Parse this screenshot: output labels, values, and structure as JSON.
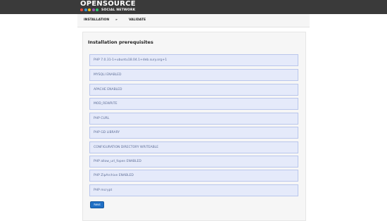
{
  "header": {
    "logo_title": "OPENSOURCE",
    "logo_subtitle": "SOCIAL NETWORK",
    "logo_dot_colors": [
      "#e84c3d",
      "#3498db",
      "#f1c40f",
      "#9b59b6",
      "#2ecc71"
    ]
  },
  "steps": {
    "installation": "INSTALLATION",
    "separator": "»",
    "validate": "VALIDATE"
  },
  "main": {
    "title": "Installation prerequisites",
    "requirements": [
      "PHP 7.0.31-1+ubuntu18.04.1+deb.sury.org+1",
      "MYSQLI ENABLED",
      "APACHE ENABLED",
      "MOD_REWRITE",
      "PHP CURL",
      "PHP GD LIBRARY",
      "CONFIGURATION DIRECTORY WRITEABLE",
      "PHP allow_url_fopen ENABLED",
      "PHP ZipArchive ENABLED",
      "PHP mcrypt"
    ],
    "next_label": "Next"
  },
  "colors": {
    "topbar": "#3a3a3a",
    "requirement_bg": "#e5eafa",
    "requirement_border": "#b9c6ec",
    "requirement_text": "#5d6d96",
    "button": "#1f6fc5"
  }
}
